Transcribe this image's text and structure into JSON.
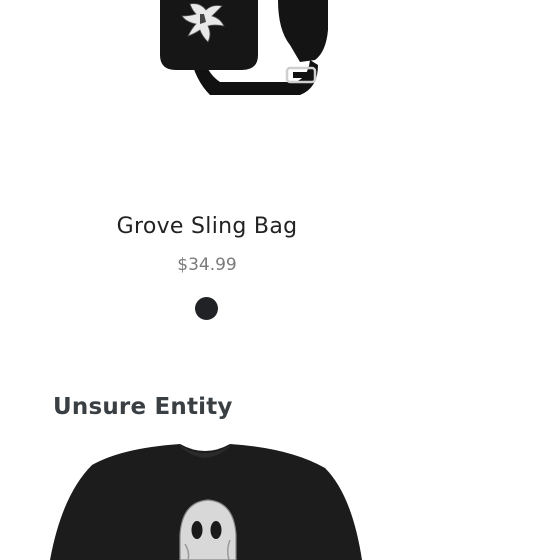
{
  "product": {
    "title": "Grove Sling Bag",
    "price": "$34.99",
    "swatch_color": "#202225",
    "image_icon": "sling-bag-image"
  },
  "section": {
    "heading": "Unsure Entity",
    "image_icon": "ghost-sweatshirt-image"
  }
}
